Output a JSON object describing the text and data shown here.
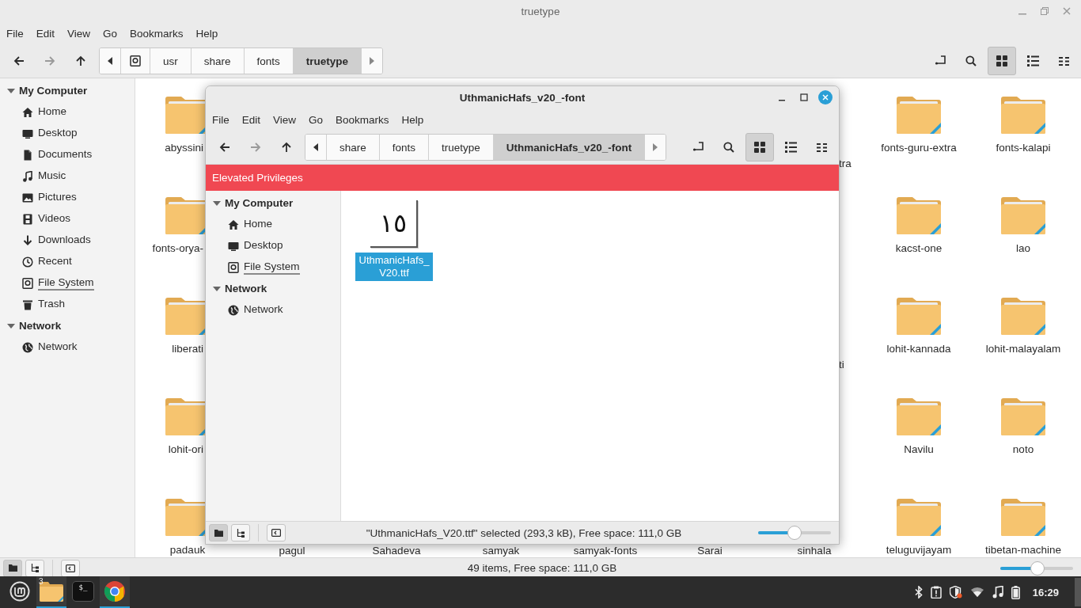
{
  "main_window": {
    "title": "truetype",
    "menu": [
      "File",
      "Edit",
      "View",
      "Go",
      "Bookmarks",
      "Help"
    ],
    "nav": [
      {
        "kind": "back",
        "disabled": false
      },
      {
        "kind": "forward",
        "disabled": true
      },
      {
        "kind": "up",
        "disabled": false
      }
    ],
    "path": [
      {
        "label": "usr",
        "selected": false
      },
      {
        "label": "share",
        "selected": false
      },
      {
        "label": "fonts",
        "selected": false
      },
      {
        "label": "truetype",
        "selected": true
      }
    ],
    "views": [
      {
        "kind": "grid",
        "selected": true
      },
      {
        "kind": "list",
        "selected": false
      },
      {
        "kind": "compact",
        "selected": false
      }
    ],
    "sidebar": [
      {
        "label": "My Computer",
        "expanded": true,
        "children": [
          {
            "label": "Home",
            "kind": "home",
            "mounted": false
          },
          {
            "label": "Desktop",
            "kind": "desktop",
            "mounted": false
          },
          {
            "label": "Documents",
            "kind": "document",
            "mounted": false
          },
          {
            "label": "Music",
            "kind": "music",
            "mounted": false
          },
          {
            "label": "Pictures",
            "kind": "picture",
            "mounted": false
          },
          {
            "label": "Videos",
            "kind": "video",
            "mounted": false
          },
          {
            "label": "Downloads",
            "kind": "download",
            "mounted": false
          },
          {
            "label": "Recent",
            "kind": "recent",
            "mounted": false
          },
          {
            "label": "File System",
            "kind": "drive",
            "mounted": true
          },
          {
            "label": "Trash",
            "kind": "trash",
            "mounted": false
          }
        ]
      },
      {
        "label": "Network",
        "expanded": true,
        "children": [
          {
            "label": "Network",
            "kind": "network",
            "mounted": false
          }
        ]
      }
    ],
    "rows": [
      {
        "items": [
          {
            "label": "abyssini",
            "kind": "cut"
          },
          {
            "label": "tra",
            "kind": "tail"
          },
          {
            "label": "fonts-guru-extra",
            "kind": "folder"
          },
          {
            "label": "fonts-kalapi",
            "kind": "folder"
          }
        ]
      },
      {
        "items": [
          {
            "label": "fonts-orya-",
            "kind": "cut"
          },
          {
            "label": "kacst-one",
            "kind": "folder"
          },
          {
            "label": "lao",
            "kind": "folder"
          }
        ]
      },
      {
        "items": [
          {
            "label": "liberati",
            "kind": "cut"
          },
          {
            "label": "ti",
            "kind": "tail"
          },
          {
            "label": "lohit-kannada",
            "kind": "folder"
          },
          {
            "label": "lohit-malayalam",
            "kind": "folder"
          }
        ]
      },
      {
        "items": [
          {
            "label": "lohit-ori",
            "kind": "cut"
          },
          {
            "label": "Navilu",
            "kind": "folder"
          },
          {
            "label": "noto",
            "kind": "folder"
          }
        ]
      },
      {
        "items": [
          {
            "label": "padauk",
            "kind": "folder"
          },
          {
            "label": "pagul",
            "kind": "label"
          },
          {
            "label": "Sahadeva",
            "kind": "label"
          },
          {
            "label": "samyak",
            "kind": "label"
          },
          {
            "label": "samyak-fonts",
            "kind": "label"
          },
          {
            "label": "Sarai",
            "kind": "label"
          },
          {
            "label": "sinhala",
            "kind": "label"
          },
          {
            "label": "teluguvijayam",
            "kind": "folder"
          },
          {
            "label": "tibetan-machine",
            "kind": "folder"
          }
        ]
      }
    ],
    "status": {
      "text": "49 items, Free space: 111,0 GB",
      "panes": [
        {
          "kind": "places",
          "selected": true
        },
        {
          "kind": "tree",
          "selected": false
        }
      ],
      "zoom": {
        "level": 0.5
      }
    }
  },
  "dialog": {
    "title": "UthmanicHafs_v20_-font",
    "menu": [
      "File",
      "Edit",
      "View",
      "Go",
      "Bookmarks",
      "Help"
    ],
    "nav": [
      {
        "kind": "back",
        "disabled": false
      },
      {
        "kind": "forward",
        "disabled": true
      },
      {
        "kind": "up",
        "disabled": false
      }
    ],
    "path": [
      {
        "label": "share",
        "selected": false
      },
      {
        "label": "fonts",
        "selected": false
      },
      {
        "label": "truetype",
        "selected": false
      },
      {
        "label": "UthmanicHafs_v20_-font",
        "selected": true
      }
    ],
    "views": [
      {
        "kind": "grid",
        "selected": true
      },
      {
        "kind": "list",
        "selected": false
      },
      {
        "kind": "compact",
        "selected": false
      }
    ],
    "banner": "Elevated Privileges",
    "sidebar": [
      {
        "label": "My Computer",
        "expanded": true,
        "children": [
          {
            "label": "Home",
            "kind": "home",
            "mounted": false
          },
          {
            "label": "Desktop",
            "kind": "desktop",
            "mounted": false
          },
          {
            "label": "File System",
            "kind": "drive",
            "mounted": true
          }
        ]
      },
      {
        "label": "Network",
        "expanded": true,
        "children": [
          {
            "label": "Network",
            "kind": "network",
            "mounted": false
          }
        ]
      }
    ],
    "files": [
      {
        "name": "UthmanicHafs_V20.ttf",
        "preview": "١٥",
        "selected": true
      }
    ],
    "status": {
      "text": "\"UthmanicHafs_V20.ttf\" selected (293,3 kB), Free space: 111,0 GB",
      "panes": [
        {
          "kind": "places",
          "selected": true
        },
        {
          "kind": "tree",
          "selected": false
        }
      ],
      "zoom": {
        "level": 0.49
      }
    }
  },
  "taskbar": {
    "apps": [
      {
        "kind": "files",
        "badge": "3",
        "active": true
      },
      {
        "kind": "terminal",
        "glyph": "$_",
        "active": false
      },
      {
        "kind": "browser",
        "active": true
      }
    ],
    "clock": "16:29"
  }
}
